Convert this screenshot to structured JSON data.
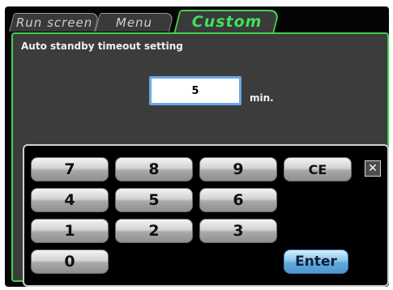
{
  "tabs": {
    "run_screen": "Run screen",
    "menu": "Menu",
    "custom": "Custom"
  },
  "setting": {
    "title": "Auto standby timeout setting",
    "value": "5",
    "unit": "min."
  },
  "keypad": {
    "k7": "7",
    "k8": "8",
    "k9": "9",
    "k4": "4",
    "k5": "5",
    "k6": "6",
    "k1": "1",
    "k2": "2",
    "k3": "3",
    "k0": "0",
    "ce": "CE",
    "enter": "Enter",
    "close": "✕"
  },
  "colors": {
    "accent": "#3fd04e",
    "input_border": "#69a9e8",
    "enter_button": "#5fa9dc"
  }
}
